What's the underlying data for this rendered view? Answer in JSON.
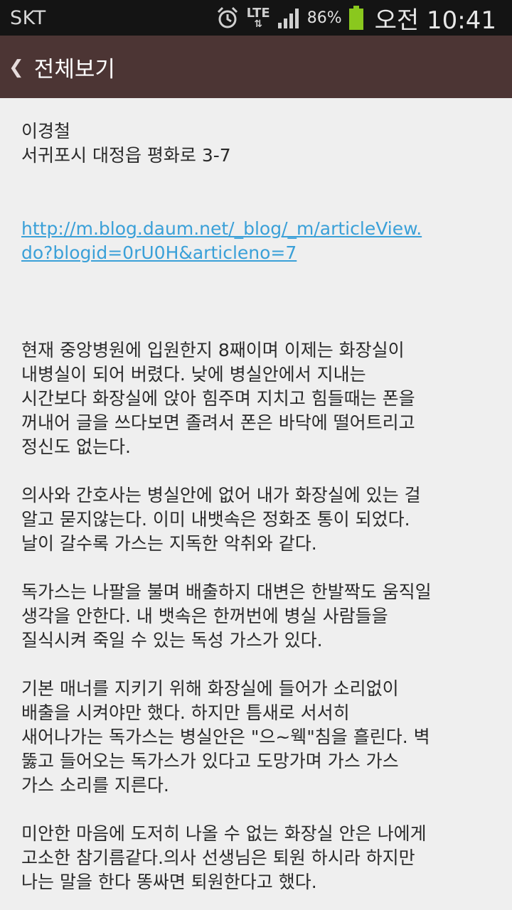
{
  "status_bar": {
    "carrier": "SKT",
    "network": "LTE",
    "battery_percent": "86%",
    "time": "오전 10:41"
  },
  "title_bar": {
    "back_glyph": "❮",
    "title": "전체보기"
  },
  "contact": {
    "name": "이경철",
    "address": "서귀포시 대정읍 평화로 3-7"
  },
  "link": {
    "line1": "http://m.blog.daum.net/_blog/_m/articleView.",
    "line2": "do?blogid=0rU0H&articleno=7"
  },
  "paragraphs": [
    [
      "현재 중앙병원에 입원한지 8째이며 이제는 화장실이",
      "내병실이 되어 버렸다. 낮에 병실안에서 지내는",
      "시간보다 화장실에 앉아 힘주며 지치고 힘들때는 폰을",
      "꺼내어 글을 쓰다보면 졸려서 폰은 바닥에 떨어트리고",
      "정신도 없는다."
    ],
    [
      "의사와 간호사는 병실안에 없어 내가 화장실에 있는 걸",
      "알고 묻지않는다. 이미 내뱃속은 정화조 통이 되었다.",
      "날이 갈수록 가스는 지독한 악취와 같다."
    ],
    [
      "독가스는 나팔을 불며 배출하지 대변은 한발짝도 움직일",
      "생각을 안한다. 내 뱃속은 한꺼번에 병실 사람들을",
      "질식시켜 죽일 수 있는 독성 가스가 있다."
    ],
    [
      "기본 매너를 지키기 위해 화장실에 들어가 소리없이",
      "배출을 시켜야만 했다. 하지만 틈새로 서서히",
      "새어나가는 독가스는 병실안은 \"으~웩\"침을 흘린다. 벽",
      "뚫고 들어오는 독가스가 있다고 도망가며 가스 가스",
      "가스 소리를 지른다."
    ],
    [
      "미안한 마음에 도저히 나올 수 없는 화장실 안은 나에게",
      "고소한 참기름같다.의사 선생님은 퇴원 하시라 하지만",
      "나는 말을 한다 똥싸면 퇴원한다고 했다."
    ]
  ],
  "colors": {
    "status_bar_bg": "#141414",
    "title_bar_bg": "#4c3534",
    "content_bg": "#efefef",
    "link": "#3aa0d8",
    "battery": "#8ac81e"
  }
}
